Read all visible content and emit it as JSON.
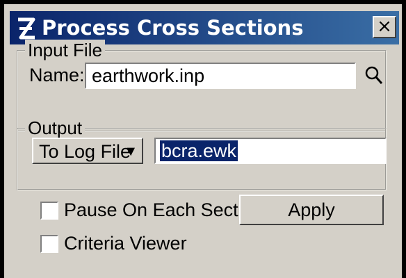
{
  "window": {
    "title": "Process Cross Sections",
    "close_label": "×"
  },
  "input_file": {
    "group_label": "Input File",
    "name_label": "Name:",
    "name_value": "earthwork.inp",
    "browse_icon": "magnifier-icon"
  },
  "output": {
    "group_label": "Output",
    "mode_label": "To Log File",
    "mode_arrow": "▼",
    "file_value": "bcra.ewk"
  },
  "options": {
    "pause_label": "Pause On Each Section",
    "pause_checked": false,
    "criteria_label": "Criteria Viewer",
    "criteria_checked": false
  },
  "actions": {
    "apply_label": "Apply"
  }
}
